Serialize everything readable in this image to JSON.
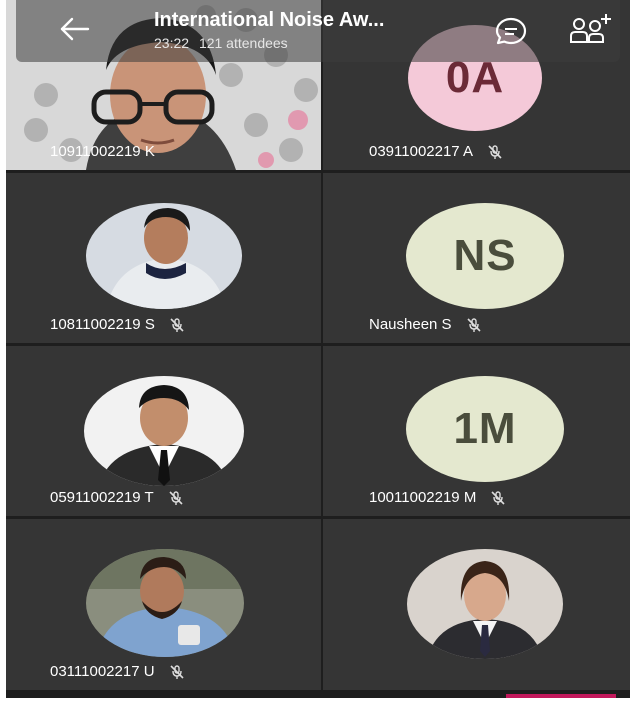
{
  "header": {
    "title": "International Noise Aw...",
    "duration": "23:22",
    "attendees": "121 attendees"
  },
  "participants": [
    {
      "label": "10911002219 K",
      "type": "video",
      "muted": false
    },
    {
      "label": "03911002217 A",
      "type": "initials",
      "initials": "0A",
      "avatar_color": "#f4c9d8",
      "muted": true
    },
    {
      "label": "10811002219 S",
      "type": "photo",
      "muted": true
    },
    {
      "label": "Nausheen S",
      "type": "initials",
      "initials": "NS",
      "avatar_color": "#e4e8cf",
      "muted": true
    },
    {
      "label": "05911002219 T",
      "type": "photo",
      "muted": true
    },
    {
      "label": "10011002219 M",
      "type": "initials",
      "initials": "1M",
      "avatar_color": "#e4e8cf",
      "muted": true
    },
    {
      "label": "03111002217 U",
      "type": "photo",
      "muted": true
    },
    {
      "label": "",
      "type": "photo",
      "muted": false
    }
  ],
  "icons": {
    "back": "arrow-left-icon",
    "chat": "chat-icon",
    "people": "add-people-icon",
    "mic_off": "mic-off-icon"
  },
  "colors": {
    "tile_bg": "#353535",
    "background": "#1e1e1e",
    "accent": "#c2185b"
  }
}
